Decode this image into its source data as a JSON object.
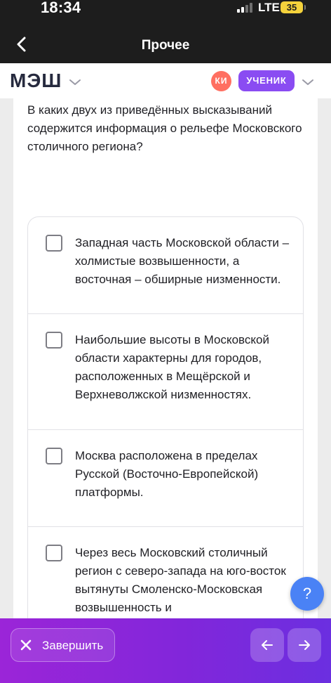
{
  "status_bar": {
    "time": "18:34",
    "network": "LTE",
    "battery": "35"
  },
  "nav": {
    "title": "Прочее",
    "back_icon": "chevron-left-icon"
  },
  "header": {
    "logo": "МЭШ",
    "avatar_initials": "КИ",
    "role": "УЧЕНИК",
    "colors": {
      "avatar": "#ff6f61",
      "role_badge": "#8a4cf2"
    }
  },
  "question": {
    "text": "В каких двух из приведённых высказываний содержится информация о рельефе Московского столичного региона?",
    "options": [
      {
        "text": "Западная часть Московской области – холмистые возвышенности, а восточная – обширные низменности.",
        "checked": false
      },
      {
        "text": "Наибольшие высоты в Московской области характерны для городов, расположенных в Мещёрской и Верхневолжской низменностях.",
        "checked": false
      },
      {
        "text": "Москва расположена в пределах Русской (Восточно-Европейской) платформы.",
        "checked": false
      },
      {
        "text": "Через весь Московский столичный регион с северо-запада на юго-восток вытянуты Смоленско-Московская возвышенность и",
        "checked": false
      }
    ]
  },
  "help": {
    "label": "?"
  },
  "bottom_bar": {
    "finish_label": "Завершить",
    "colors": {
      "gradient_start": "#9b25d8",
      "gradient_end": "#6b2fe0"
    }
  }
}
